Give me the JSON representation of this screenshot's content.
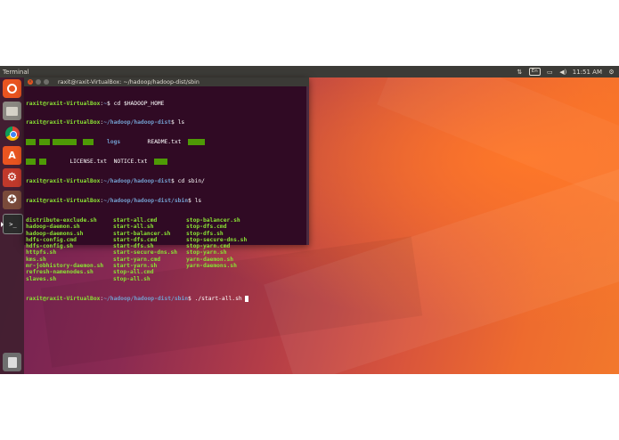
{
  "panel": {
    "app_name": "Terminal",
    "keyboard_layout": "En",
    "time": "11:51 AM",
    "icons": [
      "network-icon",
      "keyboard-icon",
      "battery-icon",
      "volume-icon",
      "power-gear-icon"
    ]
  },
  "launcher": {
    "items": [
      {
        "name": "ubuntu-dash-icon",
        "glyph": "◉"
      },
      {
        "name": "files-icon",
        "glyph": "▭"
      },
      {
        "name": "chrome-icon",
        "glyph": "◎"
      },
      {
        "name": "software-center-icon",
        "glyph": "A"
      },
      {
        "name": "settings-icon",
        "glyph": "⚙"
      },
      {
        "name": "software-updater-icon",
        "glyph": "✪"
      },
      {
        "name": "terminal-icon",
        "glyph": ">_"
      },
      {
        "name": "trash-icon",
        "glyph": "🗑"
      }
    ]
  },
  "terminal": {
    "title": "raxit@raxit-VirtualBox: ~/hadoop/hadoop-dist/sbin",
    "prompt_user": "raxit@raxit-VirtualBox",
    "line1": {
      "path": "~",
      "cmd": "cd $HADOOP_HOME"
    },
    "line2": {
      "path": "~/hadoop/hadoop-dist",
      "cmd": "ls"
    },
    "ls1": {
      "row1": {
        "logs": "logs",
        "readme": "README.txt"
      },
      "row2": {
        "license": "LICENSE.txt",
        "notice": "NOTICE.txt"
      }
    },
    "line3": {
      "path": "~/hadoop/hadoop-dist",
      "cmd": "cd sbin/"
    },
    "line4": {
      "path": "~/hadoop/hadoop-dist/sbin",
      "cmd": "ls"
    },
    "ls2": {
      "col1": [
        "distribute-exclude.sh",
        "hadoop-daemon.sh",
        "hadoop-daemons.sh",
        "hdfs-config.cmd",
        "hdfs-config.sh",
        "httpfs.sh",
        "kms.sh",
        "mr-jobhistory-daemon.sh",
        "refresh-namenodes.sh",
        "slaves.sh"
      ],
      "col2": [
        "start-all.cmd",
        "start-all.sh",
        "start-balancer.sh",
        "start-dfs.cmd",
        "start-dfs.sh",
        "start-secure-dns.sh",
        "start-yarn.cmd",
        "start-yarn.sh",
        "stop-all.cmd",
        "stop-all.sh"
      ],
      "col3": [
        "stop-balancer.sh",
        "stop-dfs.cmd",
        "stop-dfs.sh",
        "stop-secure-dns.sh",
        "stop-yarn.cmd",
        "stop-yarn.sh",
        "yarn-daemon.sh",
        "yarn-daemons.sh"
      ]
    },
    "line5": {
      "path": "~/hadoop/hadoop-dist/sbin",
      "cmd": "./start-all.sh "
    }
  }
}
